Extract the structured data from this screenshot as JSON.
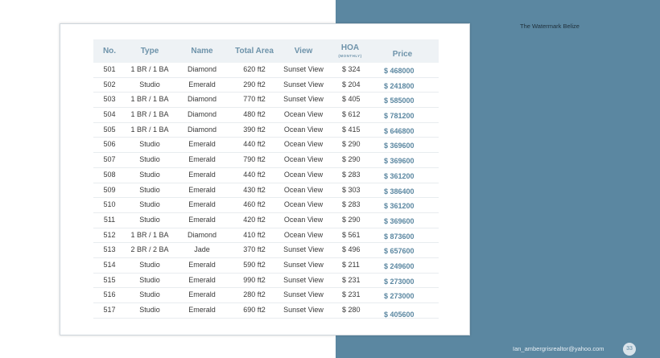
{
  "document": {
    "title": "The Watermark Belize",
    "email": "Ian_ambergrisrealtor@yahoo.com",
    "page_number": "33"
  },
  "colors": {
    "panel_blue": "#5b87a1",
    "header_text": "#6e93aa",
    "price_text": "#5b87a1"
  },
  "table": {
    "headers": {
      "no": "No.",
      "type": "Type",
      "name": "Name",
      "total_area": "Total Area",
      "view": "View",
      "hoa": "HOA",
      "hoa_sub": "(MONTHLY)",
      "price": "Price"
    },
    "rows": [
      {
        "no": "501",
        "type": "1 BR / 1 BA",
        "name": "Diamond",
        "area": "620 ft2",
        "view": "Sunset View",
        "hoa": "$ 324",
        "price": "$ 468000"
      },
      {
        "no": "502",
        "type": "Studio",
        "name": "Emerald",
        "area": "290 ft2",
        "view": "Sunset View",
        "hoa": "$ 204",
        "price": "$ 241800"
      },
      {
        "no": "503",
        "type": "1 BR / 1 BA",
        "name": "Diamond",
        "area": "770 ft2",
        "view": "Sunset View",
        "hoa": "$ 405",
        "price": "$ 585000"
      },
      {
        "no": "504",
        "type": "1 BR / 1 BA",
        "name": "Diamond",
        "area": "480 ft2",
        "view": "Ocean View",
        "hoa": "$ 612",
        "price": "$ 781200"
      },
      {
        "no": "505",
        "type": "1 BR / 1 BA",
        "name": "Diamond",
        "area": "390 ft2",
        "view": "Ocean View",
        "hoa": "$ 415",
        "price": "$ 646800"
      },
      {
        "no": "506",
        "type": "Studio",
        "name": "Emerald",
        "area": "440 ft2",
        "view": "Ocean View",
        "hoa": "$ 290",
        "price": "$ 369600"
      },
      {
        "no": "507",
        "type": "Studio",
        "name": "Emerald",
        "area": "790 ft2",
        "view": "Ocean View",
        "hoa": "$ 290",
        "price": "$ 369600"
      },
      {
        "no": "508",
        "type": "Studio",
        "name": "Emerald",
        "area": "440 ft2",
        "view": "Ocean View",
        "hoa": "$ 283",
        "price": "$ 361200"
      },
      {
        "no": "509",
        "type": "Studio",
        "name": "Emerald",
        "area": "430 ft2",
        "view": "Ocean View",
        "hoa": "$ 303",
        "price": "$ 386400"
      },
      {
        "no": "510",
        "type": "Studio",
        "name": "Emerald",
        "area": "460 ft2",
        "view": "Ocean View",
        "hoa": "$ 283",
        "price": "$ 361200"
      },
      {
        "no": "511",
        "type": "Studio",
        "name": "Emerald",
        "area": "420 ft2",
        "view": "Ocean View",
        "hoa": "$ 290",
        "price": "$ 369600"
      },
      {
        "no": "512",
        "type": "1 BR / 1 BA",
        "name": "Diamond",
        "area": "410 ft2",
        "view": "Ocean View",
        "hoa": "$ 561",
        "price": "$ 873600"
      },
      {
        "no": "513",
        "type": "2 BR / 2 BA",
        "name": "Jade",
        "area": "370 ft2",
        "view": "Sunset View",
        "hoa": "$ 496",
        "price": "$ 657600"
      },
      {
        "no": "514",
        "type": "Studio",
        "name": "Emerald",
        "area": "590 ft2",
        "view": "Sunset View",
        "hoa": "$ 211",
        "price": "$ 249600"
      },
      {
        "no": "515",
        "type": "Studio",
        "name": "Emerald",
        "area": "990 ft2",
        "view": "Sunset View",
        "hoa": "$ 231",
        "price": "$ 273000"
      },
      {
        "no": "516",
        "type": "Studio",
        "name": "Emerald",
        "area": "280 ft2",
        "view": "Sunset View",
        "hoa": "$ 231",
        "price": "$ 273000"
      },
      {
        "no": "517",
        "type": "Studio",
        "name": "Emerald",
        "area": "690 ft2",
        "view": "Sunset View",
        "hoa": "$ 280",
        "price": "$ 405600"
      }
    ]
  }
}
